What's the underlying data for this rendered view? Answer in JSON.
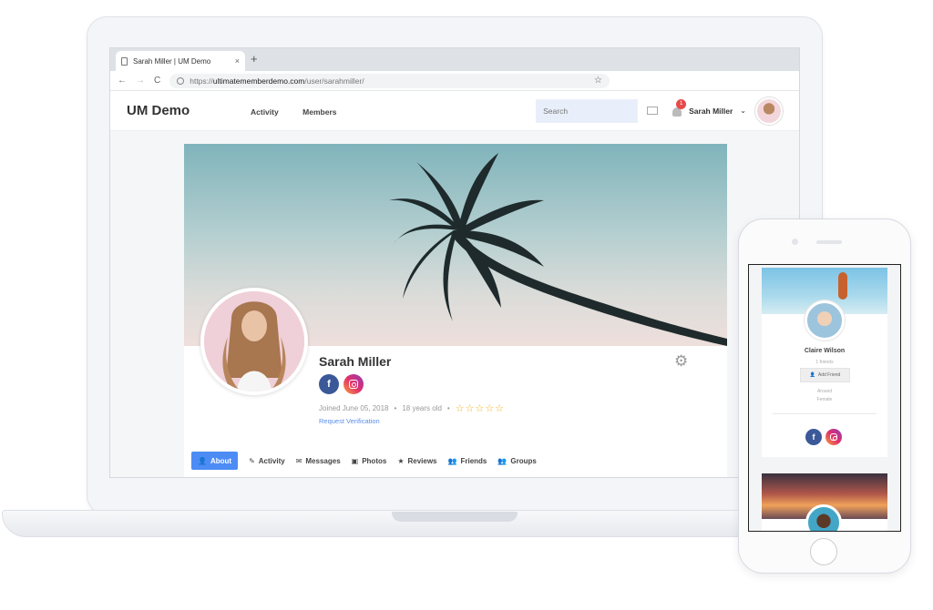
{
  "browser": {
    "tab_title": "Sarah Miller | UM Demo",
    "tab_close": "×",
    "new_tab": "+",
    "back": "←",
    "forward": "→",
    "reload": "C",
    "url_prefix": "https://",
    "url_host": "ultimatememberdemo.com",
    "url_path": "/user/sarahmiller/",
    "star": "☆"
  },
  "site": {
    "logo": "UM Demo",
    "nav": [
      "Activity",
      "Members"
    ],
    "search_placeholder": "Search",
    "notification_count": "1",
    "user_name": "Sarah Miller",
    "chevron": "⌄"
  },
  "profile": {
    "name": "Sarah Miller",
    "joined": "Joined June 05, 2018",
    "age": "18 years old",
    "dot": "•",
    "stars": "☆☆☆☆☆",
    "rating_stars": 0,
    "verify_link": "Request Verification",
    "social": {
      "facebook": "f"
    },
    "gear": "⚙",
    "tabs": [
      {
        "label": "About",
        "icon": "👤"
      },
      {
        "label": "Activity",
        "icon": "✎"
      },
      {
        "label": "Messages",
        "icon": "✉"
      },
      {
        "label": "Photos",
        "icon": "▣"
      },
      {
        "label": "Reviews",
        "icon": "★"
      },
      {
        "label": "Friends",
        "icon": "👥"
      },
      {
        "label": "Groups",
        "icon": "👥"
      }
    ]
  },
  "mobile": {
    "name": "Claire Wilson",
    "friends": "1 friends",
    "add_friend": "Add Friend",
    "add_icon": "👤",
    "meta1": "Around",
    "meta2": "Female",
    "facebook": "f"
  },
  "colors": {
    "accent": "#4d8cf5",
    "facebook": "#3b5998",
    "badge": "#e64a4a",
    "star": "#f2b01e",
    "link": "#5b8ee8"
  }
}
